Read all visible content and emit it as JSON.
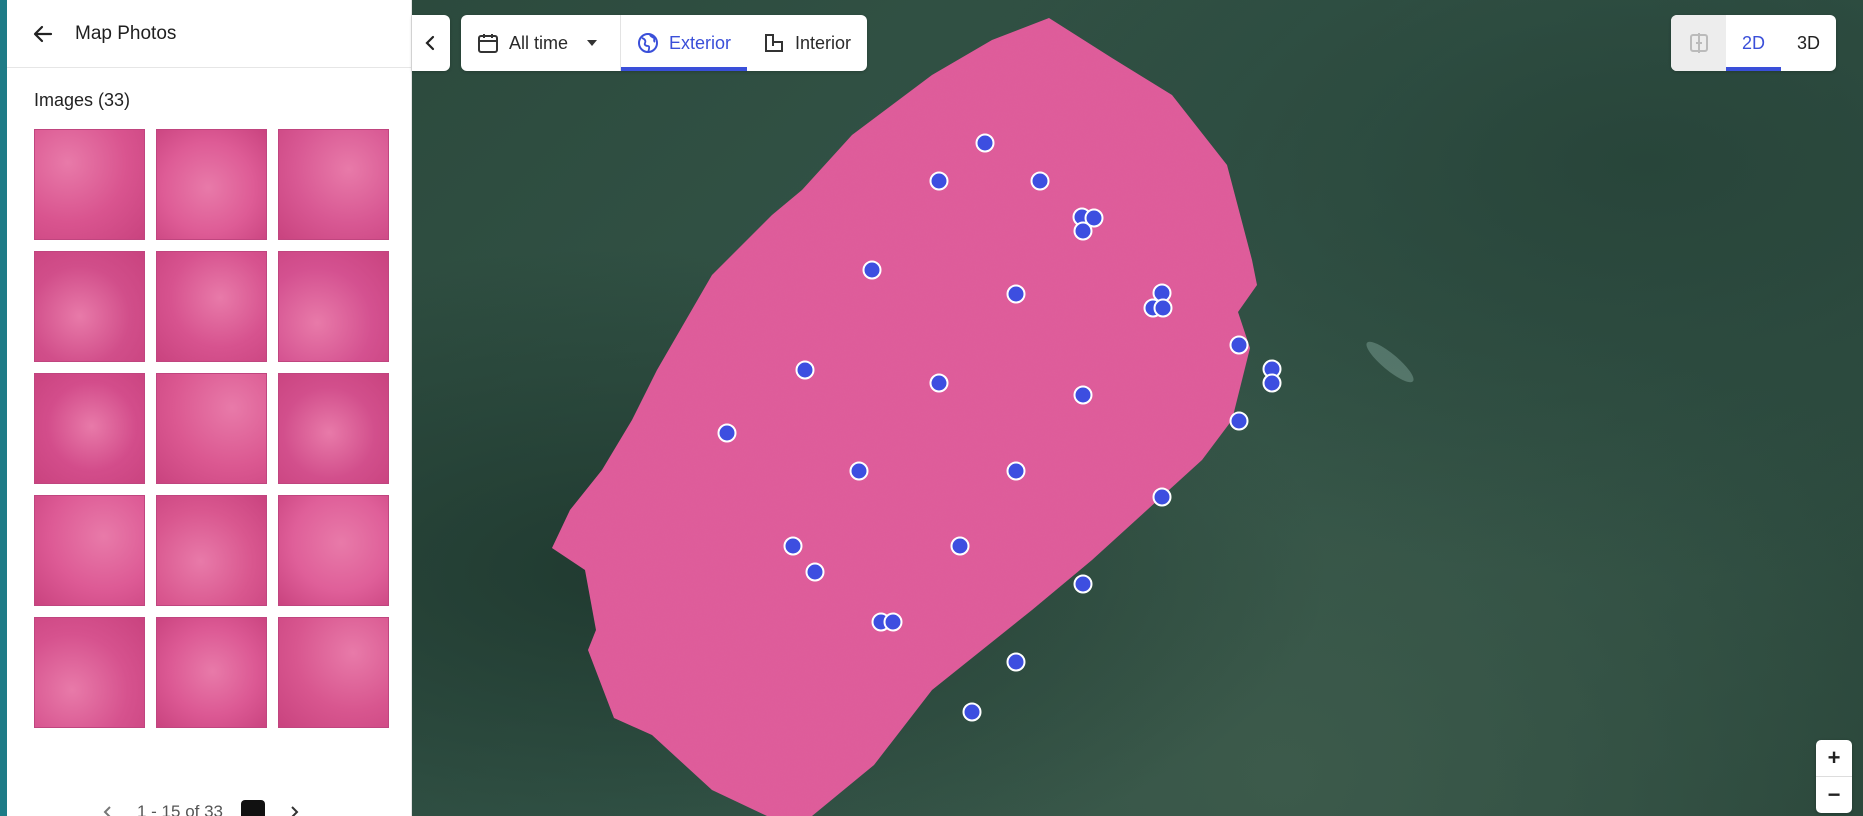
{
  "sidebar": {
    "title": "Map Photos",
    "images_heading": "Images (33)",
    "thumbnails": [
      {
        "color": "#d9548f"
      },
      {
        "color": "#de5c96"
      },
      {
        "color": "#d85893"
      },
      {
        "color": "#d14e8a"
      },
      {
        "color": "#d7538f"
      },
      {
        "color": "#d45190"
      },
      {
        "color": "#d34d8b"
      },
      {
        "color": "#db5891"
      },
      {
        "color": "#d24f8c"
      },
      {
        "color": "#dd5a95"
      },
      {
        "color": "#d9578f"
      },
      {
        "color": "#df5f99"
      },
      {
        "color": "#d6528e"
      },
      {
        "color": "#dc5994"
      },
      {
        "color": "#d8568f"
      }
    ],
    "pager": {
      "range_text": "1 - 15 of 33"
    }
  },
  "toolbar": {
    "date_filter": "All time",
    "tab_exterior": "Exterior",
    "tab_interior": "Interior",
    "active_tab": "Exterior"
  },
  "view_toggle": {
    "label_2d": "2D",
    "label_3d": "3D",
    "active": "2D"
  },
  "zoom": {
    "plus": "+",
    "minus": "−"
  },
  "colors": {
    "accent": "#3a4fd9",
    "marker": "#3d4ee0",
    "site_overlay": "#e05b9a",
    "sidebar_strip": "#1e7b86"
  },
  "icons": {
    "back": "arrow-left-icon",
    "collapse": "chevron-left-icon",
    "calendar": "calendar-icon",
    "dropdown": "caret-down-icon",
    "exterior": "globe-icon",
    "interior": "floorplan-icon",
    "compare": "split-view-icon"
  }
}
